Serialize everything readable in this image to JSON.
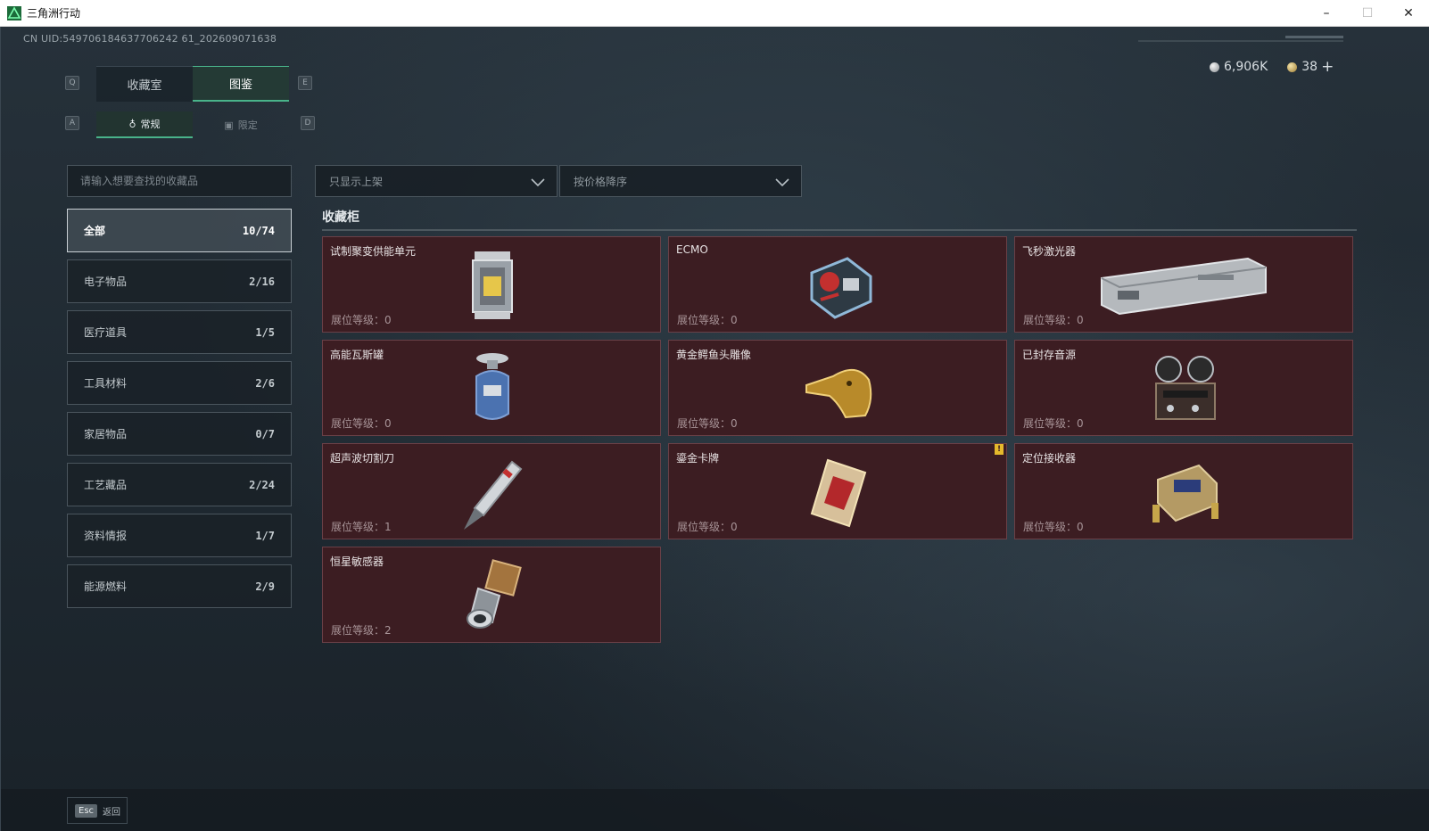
{
  "window": {
    "title": "三角洲行动",
    "minimize": "–",
    "maximize": "☐",
    "close": "✕"
  },
  "uid": "CN UID:549706184637706242 61_202609071638",
  "currency": {
    "silver": "6,906K",
    "gold": "38",
    "plus": "+"
  },
  "keys": {
    "q": "Q",
    "e": "E",
    "a": "A",
    "d": "D"
  },
  "main_tabs": [
    {
      "label": "收藏室"
    },
    {
      "label": "图鉴"
    }
  ],
  "sub_tabs": [
    {
      "label": "常规"
    },
    {
      "label": "限定"
    }
  ],
  "search": {
    "placeholder": "请输入想要查找的收藏品"
  },
  "filters": {
    "shelf": "只显示上架",
    "sort": "按价格降序"
  },
  "categories": [
    {
      "label": "全部",
      "count": "10/74"
    },
    {
      "label": "电子物品",
      "count": "2/16"
    },
    {
      "label": "医疗道具",
      "count": "1/5"
    },
    {
      "label": "工具材料",
      "count": "2/6"
    },
    {
      "label": "家居物品",
      "count": "0/7"
    },
    {
      "label": "工艺藏品",
      "count": "2/24"
    },
    {
      "label": "资料情报",
      "count": "1/7"
    },
    {
      "label": "能源燃料",
      "count": "2/9"
    }
  ],
  "section_title": "收藏柜",
  "items": [
    {
      "name": "试制聚变供能单元",
      "level": "展位等级：0",
      "icon": "fusion-cell-icon"
    },
    {
      "name": "ECMO",
      "level": "展位等级：0",
      "icon": "ecmo-machine-icon"
    },
    {
      "name": "飞秒激光器",
      "level": "展位等级：0",
      "icon": "laser-device-icon"
    },
    {
      "name": "高能瓦斯罐",
      "level": "展位等级：0",
      "icon": "gas-canister-icon"
    },
    {
      "name": "黄金鳄鱼头雕像",
      "level": "展位等级：0",
      "icon": "gold-crocodile-statue-icon"
    },
    {
      "name": "已封存音源",
      "level": "展位等级：0",
      "icon": "reel-recorder-icon"
    },
    {
      "name": "超声波切割刀",
      "level": "展位等级：1",
      "icon": "ultrasonic-cutter-icon"
    },
    {
      "name": "鎏金卡牌",
      "level": "展位等级：0",
      "icon": "gilded-card-icon",
      "warning": "!"
    },
    {
      "name": "定位接收器",
      "level": "展位等级：0",
      "icon": "positioning-receiver-icon"
    },
    {
      "name": "恒星敏感器",
      "level": "展位等级：2",
      "icon": "star-sensor-icon"
    }
  ],
  "footer": {
    "esc_key": "Esc",
    "esc_label": "返回"
  },
  "colors": {
    "accent": "#49b38a",
    "card_bg": "#3c1d22",
    "warning": "#e5b92c"
  }
}
